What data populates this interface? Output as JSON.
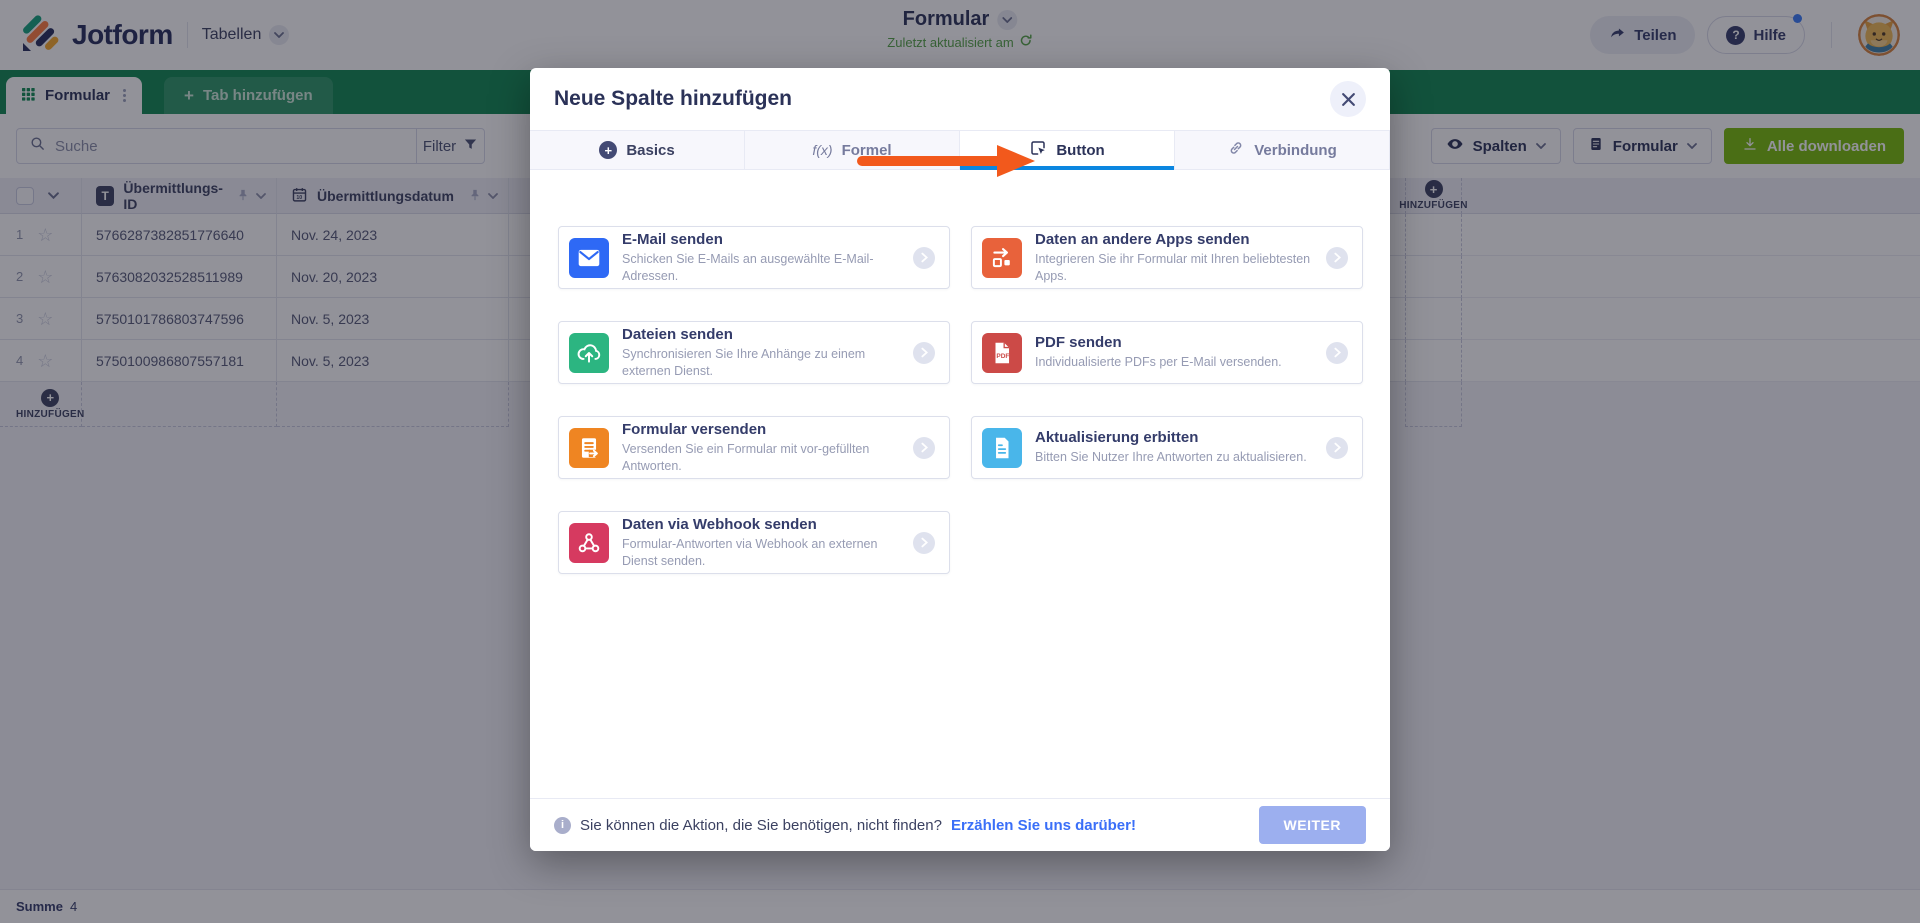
{
  "header": {
    "brand": "Jotform",
    "nav_tables": "Tabellen",
    "title": "Formular",
    "subtitle": "Zuletzt aktualisiert am",
    "subtitle_color": "#55A546",
    "share_label": "Teilen",
    "help_label": "Hilfe",
    "help_badge_color": "#3a7cf8",
    "question_glyph": "?"
  },
  "tabs_bar": {
    "bar_color": "#0E8650",
    "active_tab": "Formular",
    "add_tab": "Tab hinzufügen",
    "plus_glyph": "+"
  },
  "toolbar": {
    "search_placeholder": "Suche",
    "filter_label": "Filter",
    "columns_label": "Spalten",
    "form_label": "Formular",
    "download_label": "Alle downloaden",
    "download_color": "#78BB07"
  },
  "table": {
    "col_id_label": "Übermittlungs-ID",
    "col_id_icon_glyph": "T",
    "col_date_label": "Übermittlungsdatum",
    "add_column_label": "HINZUFÜGEN",
    "add_row_label": "HINZUFÜGEN",
    "star_glyph": "☆",
    "plus_glyph": "+",
    "rows": [
      {
        "index": "1",
        "id": "5766287382851776640",
        "date": "Nov. 24, 2023"
      },
      {
        "index": "2",
        "id": "5763082032528511989",
        "date": "Nov. 20, 2023"
      },
      {
        "index": "3",
        "id": "5750101786803747596",
        "date": "Nov. 5, 2023"
      },
      {
        "index": "4",
        "id": "5750100986807557181",
        "date": "Nov. 5, 2023"
      }
    ]
  },
  "statusbar": {
    "sum_label": "Summe",
    "sum_value": "4"
  },
  "modal": {
    "title": "Neue Spalte hinzufügen",
    "accent_blue": "#0b86e0",
    "arrow_color": "#F2591C",
    "plus_glyph": "+",
    "formula_icon_text": "f(x)",
    "tabs": [
      {
        "label": "Basics"
      },
      {
        "label": "Formel"
      },
      {
        "label": "Button"
      },
      {
        "label": "Verbindung"
      }
    ],
    "active_tab": "Button",
    "cards": [
      {
        "title": "E-Mail senden",
        "desc": "Schicken Sie E-Mails an ausgewählte E-Mail-Adressen.",
        "color": "#2E69F5",
        "icon": "envelope-icon"
      },
      {
        "title": "Daten an andere Apps senden",
        "desc": "Integrieren Sie ihr Formular mit Ihren beliebtesten Apps.",
        "color": "#E8623B",
        "icon": "apps-icon"
      },
      {
        "title": "Dateien senden",
        "desc": "Synchronisieren Sie Ihre Anhänge zu einem externen Dienst.",
        "color": "#2CB581",
        "icon": "cloud-upload-icon"
      },
      {
        "title": "PDF senden",
        "desc": "Individualisierte PDFs per E-Mail versenden.",
        "color": "#CC4A47",
        "icon": "pdf-icon"
      },
      {
        "title": "Formular versenden",
        "desc": "Versenden Sie ein Formular mit vor-gefüllten Antworten.",
        "color": "#EF8522",
        "icon": "form-send-icon"
      },
      {
        "title": "Aktualisierung erbitten",
        "desc": "Bitten Sie Nutzer Ihre Antworten zu aktualisieren.",
        "color": "#49B6EA",
        "icon": "document-icon"
      },
      {
        "title": "Daten via Webhook senden",
        "desc": "Formular-Antworten via Webhook an externen Dienst senden.",
        "color": "#D63A60",
        "icon": "webhook-icon"
      }
    ],
    "footer": {
      "info_glyph": "i",
      "info_text": "Sie können die Aktion, die Sie benötigen, nicht finden?",
      "link_text": "Erzählen Sie uns darüber!",
      "link_color": "#3a6ff8",
      "next_label": "WEITER",
      "next_button_color": "#9CAFEF"
    }
  }
}
